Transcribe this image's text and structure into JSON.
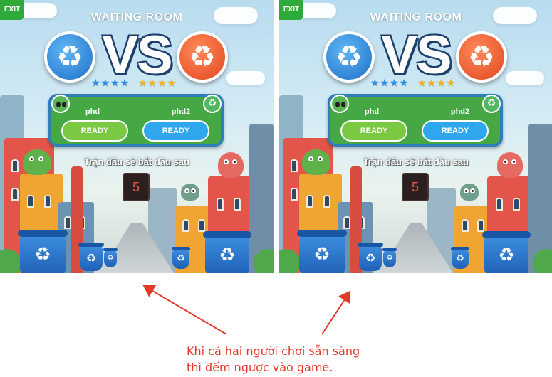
{
  "screens": [
    {
      "exit_label": "EXIT",
      "title": "WAITING ROOM",
      "vs_text": "VS",
      "badge_left_icon": "recycle-icon",
      "badge_right_icon": "recycle-icon",
      "stars_left": "★★★★",
      "stars_right": "★★★★",
      "player1": {
        "name": "phd",
        "button_label": "READY"
      },
      "player2": {
        "name": "phd2",
        "button_label": "READY"
      },
      "countdown_label": "Trận đấu sẽ bắt đầu sau",
      "countdown_value": "5"
    },
    {
      "exit_label": "EXIT",
      "title": "WAITING ROOM",
      "vs_text": "VS",
      "badge_left_icon": "recycle-icon",
      "badge_right_icon": "recycle-icon",
      "stars_left": "★★★★",
      "stars_right": "★★★★",
      "player1": {
        "name": "phd",
        "button_label": "READY"
      },
      "player2": {
        "name": "phd2",
        "button_label": "READY"
      },
      "countdown_label": "Trận đấu sẽ bắt đầu sau",
      "countdown_value": "5"
    }
  ],
  "annotation": {
    "line1": "Khi cả hai người chơi sẵn sàng",
    "line2": "thì đếm ngược vào game."
  },
  "colors": {
    "exit_button": "#2eaa3a",
    "player_panel": "#46a844",
    "ready_left": "#7bc943",
    "ready_right": "#2ea7ef",
    "badge_blue": "#1f6fc8",
    "badge_red": "#e2461e",
    "annotation_text": "#e23a2a"
  }
}
